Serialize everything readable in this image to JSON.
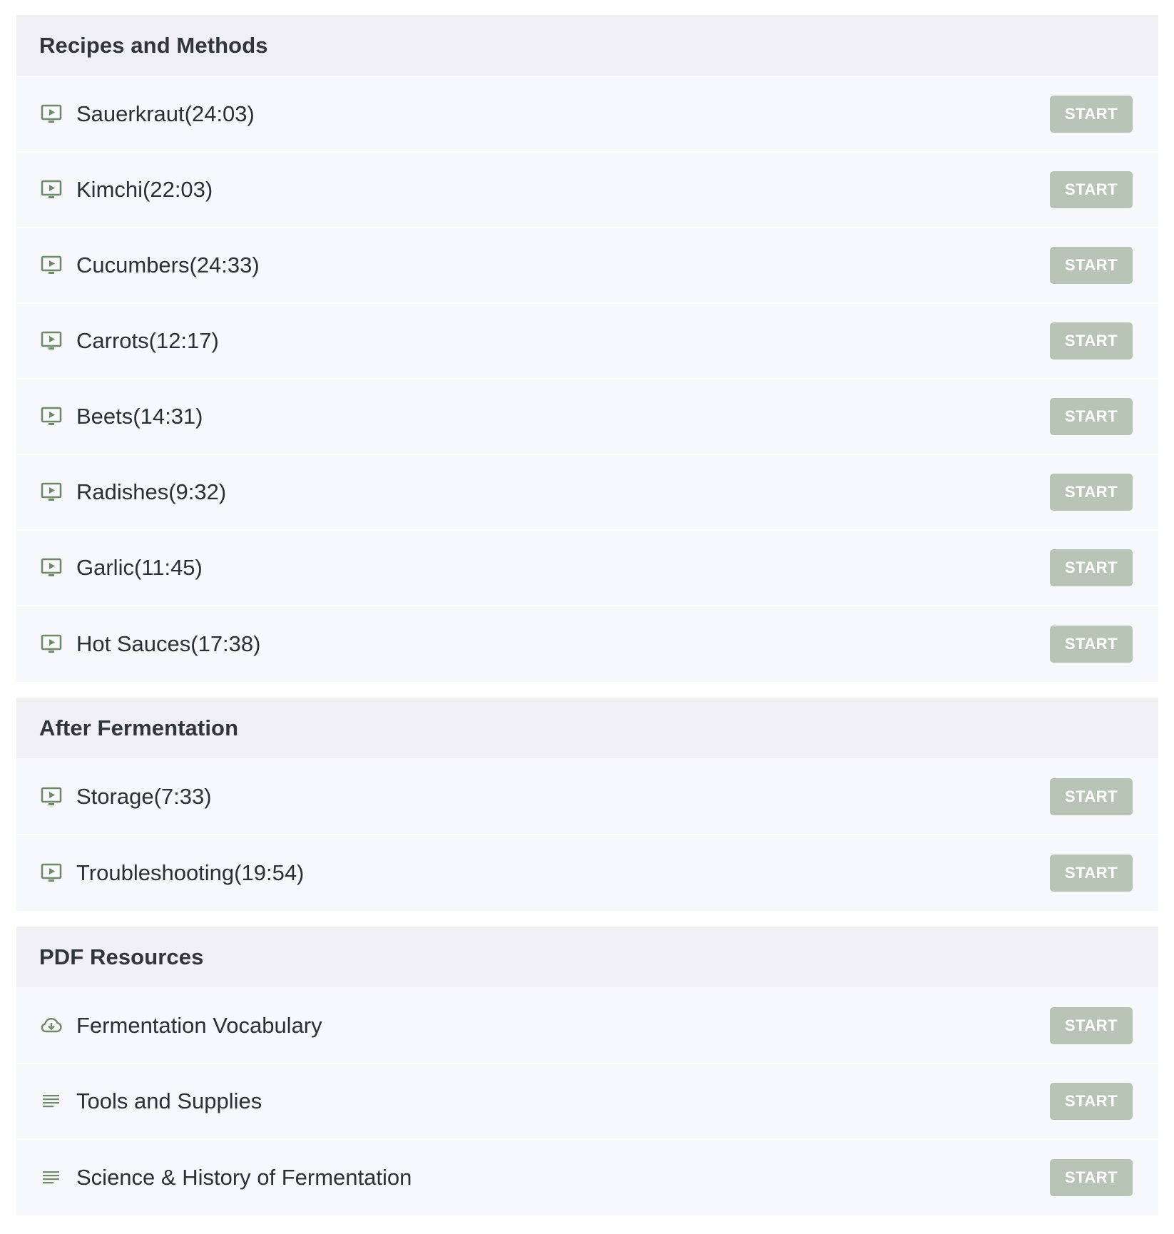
{
  "colors": {
    "accent_icon": "#6f8a6b",
    "button_bg": "#b8c4b5",
    "header_bg": "#efeff4",
    "row_bg": "#f7f8fb"
  },
  "sections": [
    {
      "title": "Recipes and Methods",
      "lessons": [
        {
          "icon": "video-icon",
          "title": "Sauerkraut(24:03)",
          "button": "START"
        },
        {
          "icon": "video-icon",
          "title": "Kimchi(22:03)",
          "button": "START"
        },
        {
          "icon": "video-icon",
          "title": "Cucumbers(24:33)",
          "button": "START"
        },
        {
          "icon": "video-icon",
          "title": "Carrots(12:17)",
          "button": "START"
        },
        {
          "icon": "video-icon",
          "title": "Beets(14:31)",
          "button": "START"
        },
        {
          "icon": "video-icon",
          "title": "Radishes(9:32)",
          "button": "START"
        },
        {
          "icon": "video-icon",
          "title": "Garlic(11:45)",
          "button": "START"
        },
        {
          "icon": "video-icon",
          "title": "Hot Sauces(17:38)",
          "button": "START"
        }
      ]
    },
    {
      "title": "After Fermentation",
      "lessons": [
        {
          "icon": "video-icon",
          "title": "Storage(7:33)",
          "button": "START"
        },
        {
          "icon": "video-icon",
          "title": "Troubleshooting(19:54)",
          "button": "START"
        }
      ]
    },
    {
      "title": "PDF Resources",
      "lessons": [
        {
          "icon": "cloud-download-icon",
          "title": "Fermentation Vocabulary",
          "button": "START"
        },
        {
          "icon": "text-lines-icon",
          "title": "Tools and Supplies",
          "button": "START"
        },
        {
          "icon": "text-lines-icon",
          "title": "Science & History of Fermentation",
          "button": "START"
        }
      ]
    }
  ]
}
